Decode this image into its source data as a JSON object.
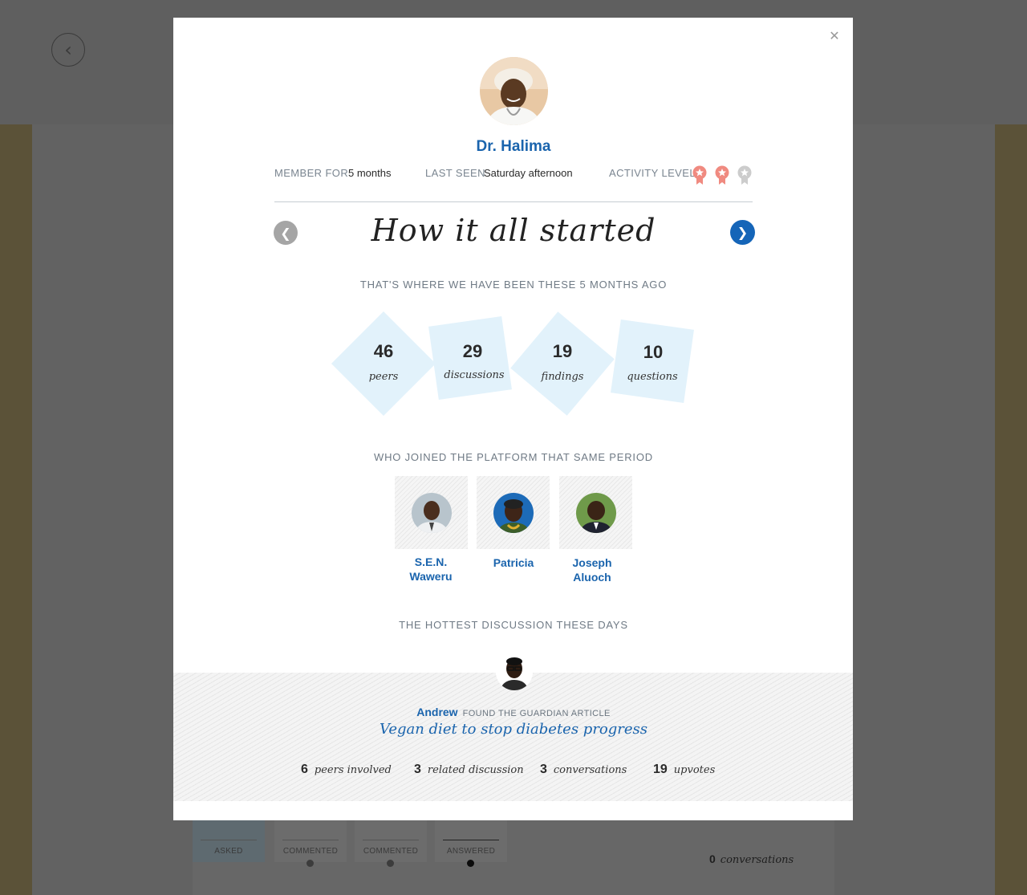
{
  "profile": {
    "name": "Dr. Halima",
    "member_for_label": "MEMBER FOR",
    "member_for_value": "5 months",
    "last_seen_label": "LAST SEEN",
    "last_seen_value": "Saturday afternoon",
    "activity_label": "ACTIVITY LEVEL",
    "activity_level": 2,
    "activity_max": 3
  },
  "slide": {
    "title": "How it all started",
    "intro": "THAT'S WHERE WE HAVE BEEN THESE 5 MONTHS AGO"
  },
  "stats": [
    {
      "value": "46",
      "label": "peers"
    },
    {
      "value": "29",
      "label": "discussions"
    },
    {
      "value": "19",
      "label": "findings"
    },
    {
      "value": "10",
      "label": "questions"
    }
  ],
  "joined": {
    "heading": "WHO JOINED THE PLATFORM THAT SAME PERIOD",
    "people": [
      {
        "name_line1": "S.E.N.",
        "name_line2": "Waweru"
      },
      {
        "name_line1": "Patricia",
        "name_line2": ""
      },
      {
        "name_line1": "Joseph",
        "name_line2": "Aluoch"
      }
    ]
  },
  "hottest": {
    "heading": "THE HOTTEST DISCUSSION THESE DAYS",
    "author": "Andrew",
    "action": "FOUND THE GUARDIAN ARTICLE",
    "title": "Vegan diet to stop diabetes progress",
    "stats": [
      {
        "value": "6",
        "label": "peers involved"
      },
      {
        "value": "3",
        "label": "related discussion"
      },
      {
        "value": "3",
        "label": "conversations"
      },
      {
        "value": "19",
        "label": "upvotes"
      }
    ]
  },
  "background": {
    "tabs": [
      "ASKED",
      "COMMENTED",
      "COMMENTED",
      "ANSWERED"
    ],
    "conversations_count": "0",
    "conversations_label": "conversations"
  },
  "icons": {
    "close": "close-icon",
    "back": "back-arrow-icon",
    "prev": "chevron-left-icon",
    "next": "chevron-right-icon",
    "activity": "star-badge-icon"
  },
  "colors": {
    "accent": "#1565b8",
    "link": "#1a64ad",
    "stat_bg": "#e2f2fb",
    "star_active": "#f08a80",
    "star_inactive": "#cccccc"
  }
}
